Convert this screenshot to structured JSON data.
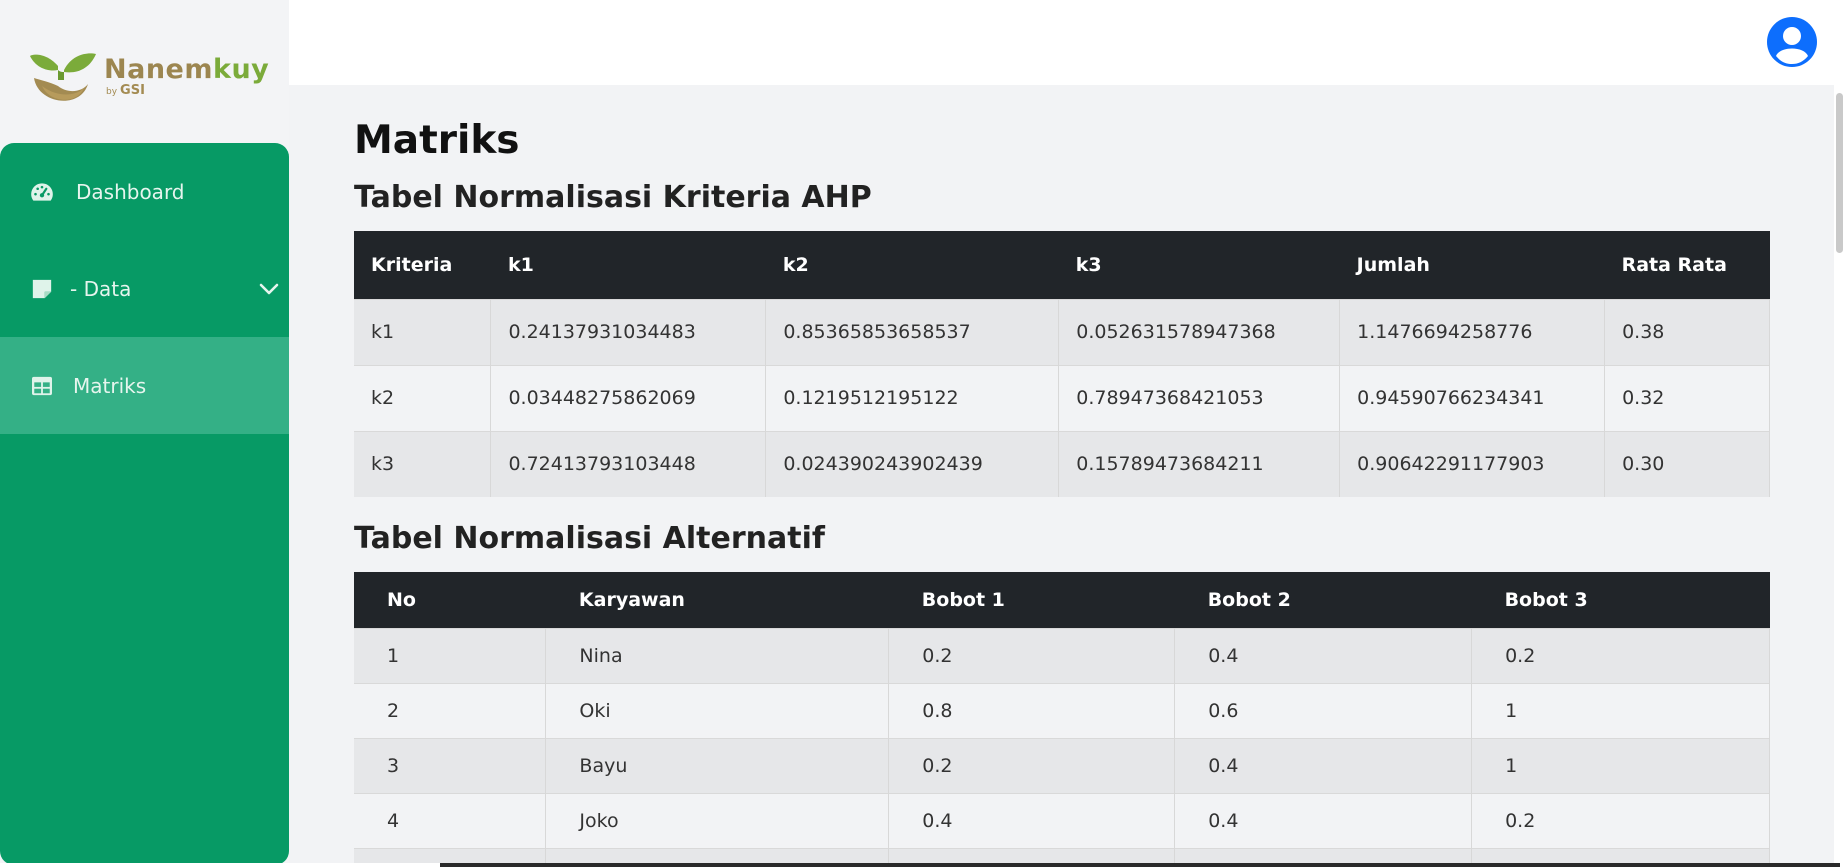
{
  "brand": {
    "name_part1": "Nanem",
    "name_part2": "kuy",
    "by": "by",
    "company": "GSI"
  },
  "sidebar": {
    "items": [
      {
        "label": "Dashboard",
        "icon": "gauge-icon"
      },
      {
        "label": "- Data",
        "icon": "sticky-note-icon",
        "expandable": true
      },
      {
        "label": "Matriks",
        "icon": "table-icon",
        "active": true
      }
    ]
  },
  "header": {
    "avatar_icon": "user-circle-icon"
  },
  "page": {
    "title": "Matriks",
    "section1_title": "Tabel Normalisasi Kriteria AHP",
    "section2_title": "Tabel Normalisasi Alternatif"
  },
  "table_ahp": {
    "headers": [
      "Kriteria",
      "k1",
      "k2",
      "k3",
      "Jumlah",
      "Rata Rata"
    ],
    "rows": [
      [
        "k1",
        "0.24137931034483",
        "0.85365853658537",
        "0.052631578947368",
        "1.1476694258776",
        "0.38"
      ],
      [
        "k2",
        "0.03448275862069",
        "0.1219512195122",
        "0.78947368421053",
        "0.94590766234341",
        "0.32"
      ],
      [
        "k3",
        "0.72413793103448",
        "0.024390243902439",
        "0.15789473684211",
        "0.90642291177903",
        "0.30"
      ]
    ]
  },
  "table_alt": {
    "headers": [
      "No",
      "Karyawan",
      "Bobot 1",
      "Bobot 2",
      "Bobot 3"
    ],
    "rows": [
      [
        "1",
        "Nina",
        "0.2",
        "0.4",
        "0.2"
      ],
      [
        "2",
        "Oki",
        "0.8",
        "0.6",
        "1"
      ],
      [
        "3",
        "Bayu",
        "0.2",
        "0.4",
        "1"
      ],
      [
        "4",
        "Joko",
        "0.4",
        "0.4",
        "0.2"
      ]
    ]
  },
  "colors": {
    "sidebar_green": "#079a65",
    "active_green": "#34b086",
    "table_header": "#212529",
    "avatar_blue": "#0d6efd"
  }
}
